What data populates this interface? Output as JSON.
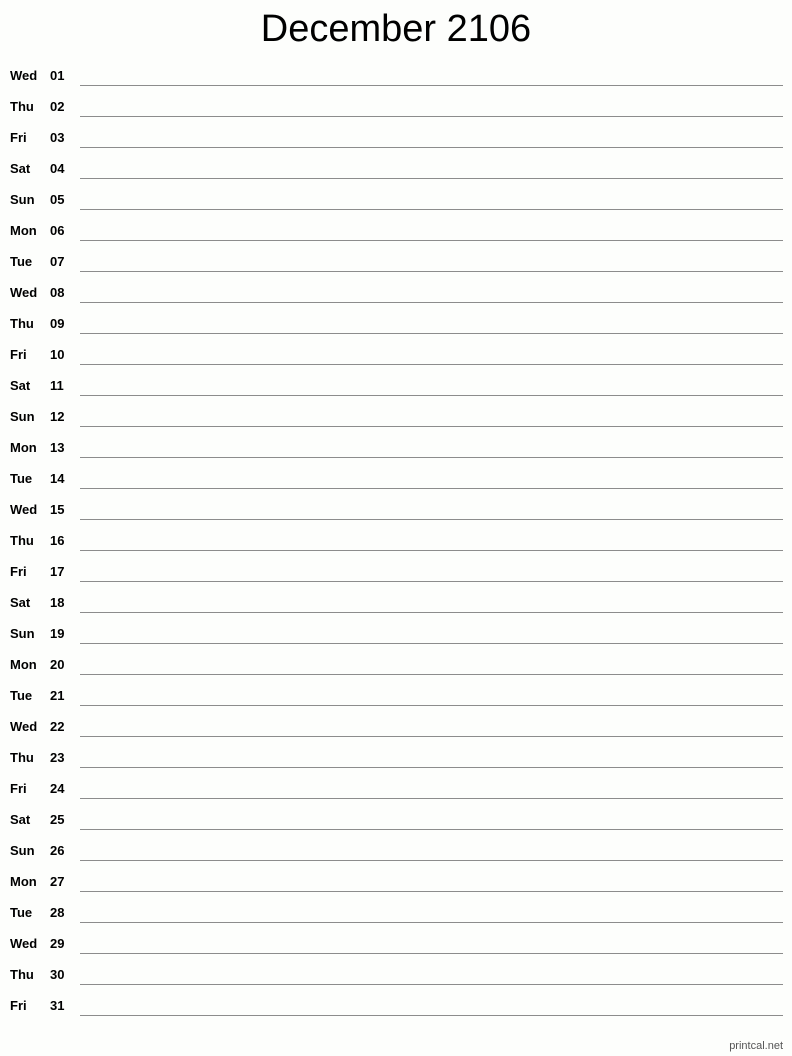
{
  "title": "December 2106",
  "days": [
    {
      "dow": "Wed",
      "num": "01"
    },
    {
      "dow": "Thu",
      "num": "02"
    },
    {
      "dow": "Fri",
      "num": "03"
    },
    {
      "dow": "Sat",
      "num": "04"
    },
    {
      "dow": "Sun",
      "num": "05"
    },
    {
      "dow": "Mon",
      "num": "06"
    },
    {
      "dow": "Tue",
      "num": "07"
    },
    {
      "dow": "Wed",
      "num": "08"
    },
    {
      "dow": "Thu",
      "num": "09"
    },
    {
      "dow": "Fri",
      "num": "10"
    },
    {
      "dow": "Sat",
      "num": "11"
    },
    {
      "dow": "Sun",
      "num": "12"
    },
    {
      "dow": "Mon",
      "num": "13"
    },
    {
      "dow": "Tue",
      "num": "14"
    },
    {
      "dow": "Wed",
      "num": "15"
    },
    {
      "dow": "Thu",
      "num": "16"
    },
    {
      "dow": "Fri",
      "num": "17"
    },
    {
      "dow": "Sat",
      "num": "18"
    },
    {
      "dow": "Sun",
      "num": "19"
    },
    {
      "dow": "Mon",
      "num": "20"
    },
    {
      "dow": "Tue",
      "num": "21"
    },
    {
      "dow": "Wed",
      "num": "22"
    },
    {
      "dow": "Thu",
      "num": "23"
    },
    {
      "dow": "Fri",
      "num": "24"
    },
    {
      "dow": "Sat",
      "num": "25"
    },
    {
      "dow": "Sun",
      "num": "26"
    },
    {
      "dow": "Mon",
      "num": "27"
    },
    {
      "dow": "Tue",
      "num": "28"
    },
    {
      "dow": "Wed",
      "num": "29"
    },
    {
      "dow": "Thu",
      "num": "30"
    },
    {
      "dow": "Fri",
      "num": "31"
    }
  ],
  "footer": {
    "credit": "printcal.net"
  }
}
